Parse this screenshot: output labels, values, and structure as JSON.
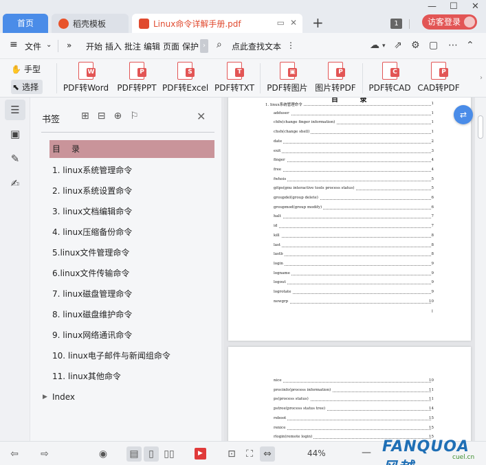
{
  "tabs": {
    "home": "首页",
    "template": "稻壳模板",
    "document": "Linux命令详解手册.pdf",
    "new_tab": "+",
    "count_badge": "1",
    "login": "访客登录"
  },
  "window": {
    "minimize": "—",
    "maximize": "☐",
    "close": "✕"
  },
  "menu": {
    "file": "文件",
    "items": [
      "开始",
      "插入",
      "批注",
      "编辑",
      "页面",
      "保护"
    ],
    "search": "点此查找文本"
  },
  "ribbon": {
    "hand": "手型",
    "select": "选择",
    "buttons": [
      {
        "label": "PDF转Word",
        "tag": "W"
      },
      {
        "label": "PDF转PPT",
        "tag": "P"
      },
      {
        "label": "PDF转Excel",
        "tag": "S"
      },
      {
        "label": "PDF转TXT",
        "tag": "T"
      },
      {
        "label": "PDF转图片",
        "tag": "▣"
      },
      {
        "label": "图片转PDF",
        "tag": "P"
      },
      {
        "label": "PDF转CAD",
        "tag": "C"
      },
      {
        "label": "CAD转PDF",
        "tag": "P"
      }
    ]
  },
  "bookmarks": {
    "title": "书签",
    "items": [
      "目　录",
      "1. linux系统管理命令",
      "2. linux系统设置命令",
      "3. linux文档编辑命令",
      "4. linux压缩备份命令",
      "5.linux文件管理命令",
      "6.linux文件传输命令",
      "7. linux磁盘管理命令",
      "8. linux磁盘维护命令",
      "9. linux网络通讯命令",
      "10. linux电子邮件与新闻组命令",
      "11. linux其他命令",
      "Index"
    ]
  },
  "document": {
    "page1_heading": "目 录",
    "page1_entries": [
      {
        "text": "1. linux系统管理命令",
        "page": "1"
      },
      {
        "text": "adduser",
        "page": "1"
      },
      {
        "text": "chfn(change finger information)",
        "page": "1"
      },
      {
        "text": "chsh(change shell)",
        "page": "1"
      },
      {
        "text": "date",
        "page": "2"
      },
      {
        "text": "exit",
        "page": "3"
      },
      {
        "text": "finger",
        "page": "4"
      },
      {
        "text": "free",
        "page": "4"
      },
      {
        "text": "fwhois",
        "page": "5"
      },
      {
        "text": "gitps(gnu interactive tools process status)",
        "page": "5"
      },
      {
        "text": "groupdel(group delete)",
        "page": "6"
      },
      {
        "text": "groupmod(group modify)",
        "page": "6"
      },
      {
        "text": "halt",
        "page": "7"
      },
      {
        "text": "id",
        "page": "7"
      },
      {
        "text": "kill",
        "page": "8"
      },
      {
        "text": "last",
        "page": "8"
      },
      {
        "text": "lastb",
        "page": "8"
      },
      {
        "text": "login",
        "page": "9"
      },
      {
        "text": "logname",
        "page": "9"
      },
      {
        "text": "logout",
        "page": "9"
      },
      {
        "text": "logrotate",
        "page": "9"
      },
      {
        "text": "newgrp",
        "page": "10"
      }
    ],
    "page1_number": "I",
    "page2_entries": [
      {
        "text": "nice",
        "page": "10"
      },
      {
        "text": "procinfo(process information)",
        "page": "11"
      },
      {
        "text": "ps(process status)",
        "page": "11"
      },
      {
        "text": "pstree(process status tree)",
        "page": "14"
      },
      {
        "text": "reboot",
        "page": "15"
      },
      {
        "text": "renice",
        "page": "15"
      },
      {
        "text": "rlogin(remote login)",
        "page": "15"
      }
    ]
  },
  "statusbar": {
    "zoom": "44%"
  },
  "watermark": {
    "text": "FANQUOA 风越",
    "sub": "cuel.cn"
  }
}
